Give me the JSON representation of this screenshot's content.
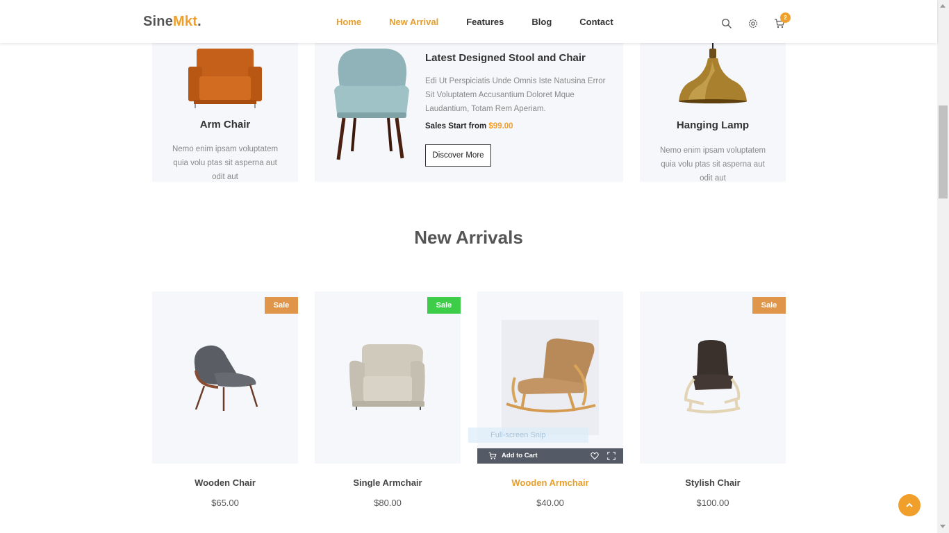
{
  "logo": {
    "main": "Sine",
    "accent": "Mkt",
    "dot": "."
  },
  "nav": [
    "Home",
    "New Arrival",
    "Features",
    "Blog",
    "Contact"
  ],
  "cart": {
    "count": "2"
  },
  "icons": [
    "search-icon",
    "settings-icon",
    "cart-icon"
  ],
  "top_cards": {
    "left": {
      "title": "Arm Chair",
      "desc": "Nemo enim ipsam voluptatem quia volu ptas sit asperna aut odit aut"
    },
    "promo": {
      "title": "Latest Designed Stool and Chair",
      "desc": "Edi Ut Perspiciatis Unde Omnis Iste Natusina Error Sit Voluptatem Accusantium Doloret Mque Laudantium, Totam Rem Aperiam.",
      "sale_label": "Sales Start from",
      "sale_price": "$99.00",
      "button": "Discover More"
    },
    "right": {
      "title": "Hanging Lamp",
      "desc": "Nemo enim ipsam voluptatem quia volu ptas sit asperna aut odit aut"
    }
  },
  "section_title": "New Arrivals",
  "products": [
    {
      "name": "Wooden Chair",
      "price": "$65.00",
      "badge": "Sale",
      "badge_color": "#e0964a"
    },
    {
      "name": "Single Armchair",
      "price": "$80.00",
      "badge": "Sale",
      "badge_color": "#3dcd49"
    },
    {
      "name": "Wooden Armchair",
      "price": "$40.00",
      "badge": ""
    },
    {
      "name": "Stylish Chair",
      "price": "$100.00",
      "badge": "Sale",
      "badge_color": "#e0964a"
    }
  ],
  "hover_bar": {
    "add_to_cart": "Add to Cart"
  },
  "snip_tooltip": "Full-screen Snip",
  "colors": {
    "accent": "#f0a02a",
    "sale_orange": "#e0964a",
    "sale_green": "#3dcd49",
    "card_bg": "#f6f7fb"
  }
}
